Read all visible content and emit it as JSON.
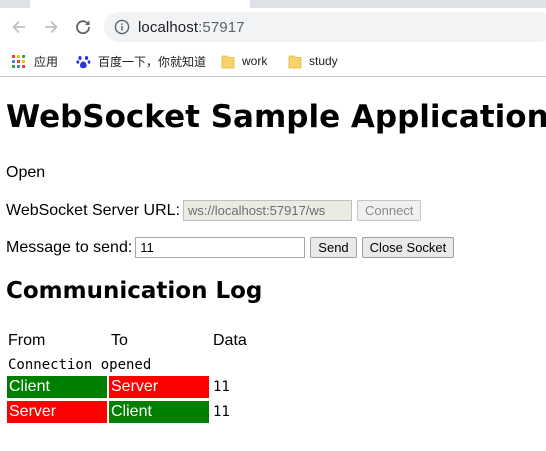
{
  "browser": {
    "url_host": "localhost",
    "url_port": ":57917",
    "icons": [
      "back-arrow-icon",
      "forward-arrow-icon",
      "reload-icon",
      "info-icon"
    ],
    "bookmarks": [
      {
        "label": "应用",
        "icon": "apps-grid-icon"
      },
      {
        "label": "百度一下，你就知道",
        "icon": "baidu-paw-icon"
      },
      {
        "label": "work",
        "icon": "folder-icon"
      },
      {
        "label": "study",
        "icon": "folder-icon"
      }
    ]
  },
  "page": {
    "title": "WebSocket Sample Application",
    "status": "Open",
    "url_label": "WebSocket Server URL:",
    "url_value": "ws://localhost:57917/ws",
    "connect_label": "Connect",
    "message_label": "Message to send:",
    "message_value": "11",
    "send_label": "Send",
    "close_label": "Close Socket",
    "log_title": "Communication Log"
  },
  "log": {
    "headers": [
      "From",
      "To",
      "Data"
    ],
    "note": "Connection opened",
    "rows": [
      {
        "from": "Client",
        "to": "Server",
        "data": "11"
      },
      {
        "from": "Server",
        "to": "Client",
        "data": "11"
      }
    ]
  },
  "colors": {
    "client": "#008000",
    "server": "#ff0000",
    "folder": "#f7d46a"
  }
}
